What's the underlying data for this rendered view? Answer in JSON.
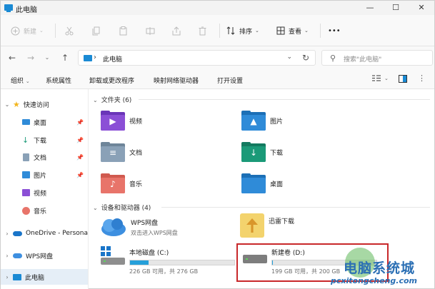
{
  "window": {
    "title": "此电脑"
  },
  "window_controls": [
    "—",
    "☐",
    "✕"
  ],
  "cmdbar": {
    "new_label": "新建",
    "sort_label": "排序",
    "view_label": "查看",
    "more": "•••"
  },
  "address": {
    "path": "此电脑",
    "sep": "›",
    "search_placeholder": "搜索\"此电脑\""
  },
  "ribbon": {
    "items": [
      "组织",
      "系统属性",
      "卸载或更改程序",
      "映射网络驱动器",
      "打开设置"
    ]
  },
  "sidebar": {
    "quick_access": "快速访问",
    "quick_items": [
      "桌面",
      "下载",
      "文档",
      "图片",
      "视频",
      "音乐"
    ],
    "onedrive": "OneDrive - Persona",
    "wps": "WPS网盘",
    "this_pc": "此电脑"
  },
  "folders_section": {
    "title": "文件夹 (6)"
  },
  "folders": [
    {
      "label": "视频",
      "color": "#8b4fd6"
    },
    {
      "label": "图片",
      "color": "#2f8bd8"
    },
    {
      "label": "文档",
      "color": "#8aa1b7"
    },
    {
      "label": "下载",
      "color": "#1b9a78"
    },
    {
      "label": "音乐",
      "color": "#e8746a"
    },
    {
      "label": "桌面",
      "color": "#2f8bd8"
    }
  ],
  "devices_section": {
    "title": "设备和驱动器 (4)"
  },
  "devices": [
    {
      "name": "WPS网盘",
      "sub": "双击进入WPS网盘"
    },
    {
      "name": "迅雷下载",
      "sub": ""
    },
    {
      "name": "本地磁盘 (C:)",
      "sub": "226 GB 可用，共 276 GB",
      "used_fraction": 0.18
    },
    {
      "name": "新建卷 (D:)",
      "sub": "199 GB 可用，共 200 GB",
      "used_fraction": 0.005
    }
  ],
  "watermark": {
    "line1": "电脑系统城",
    "line2": "pcxitongcheng.com"
  },
  "colors": {
    "accent": "#26a0da",
    "highlight": "#c8282a"
  }
}
